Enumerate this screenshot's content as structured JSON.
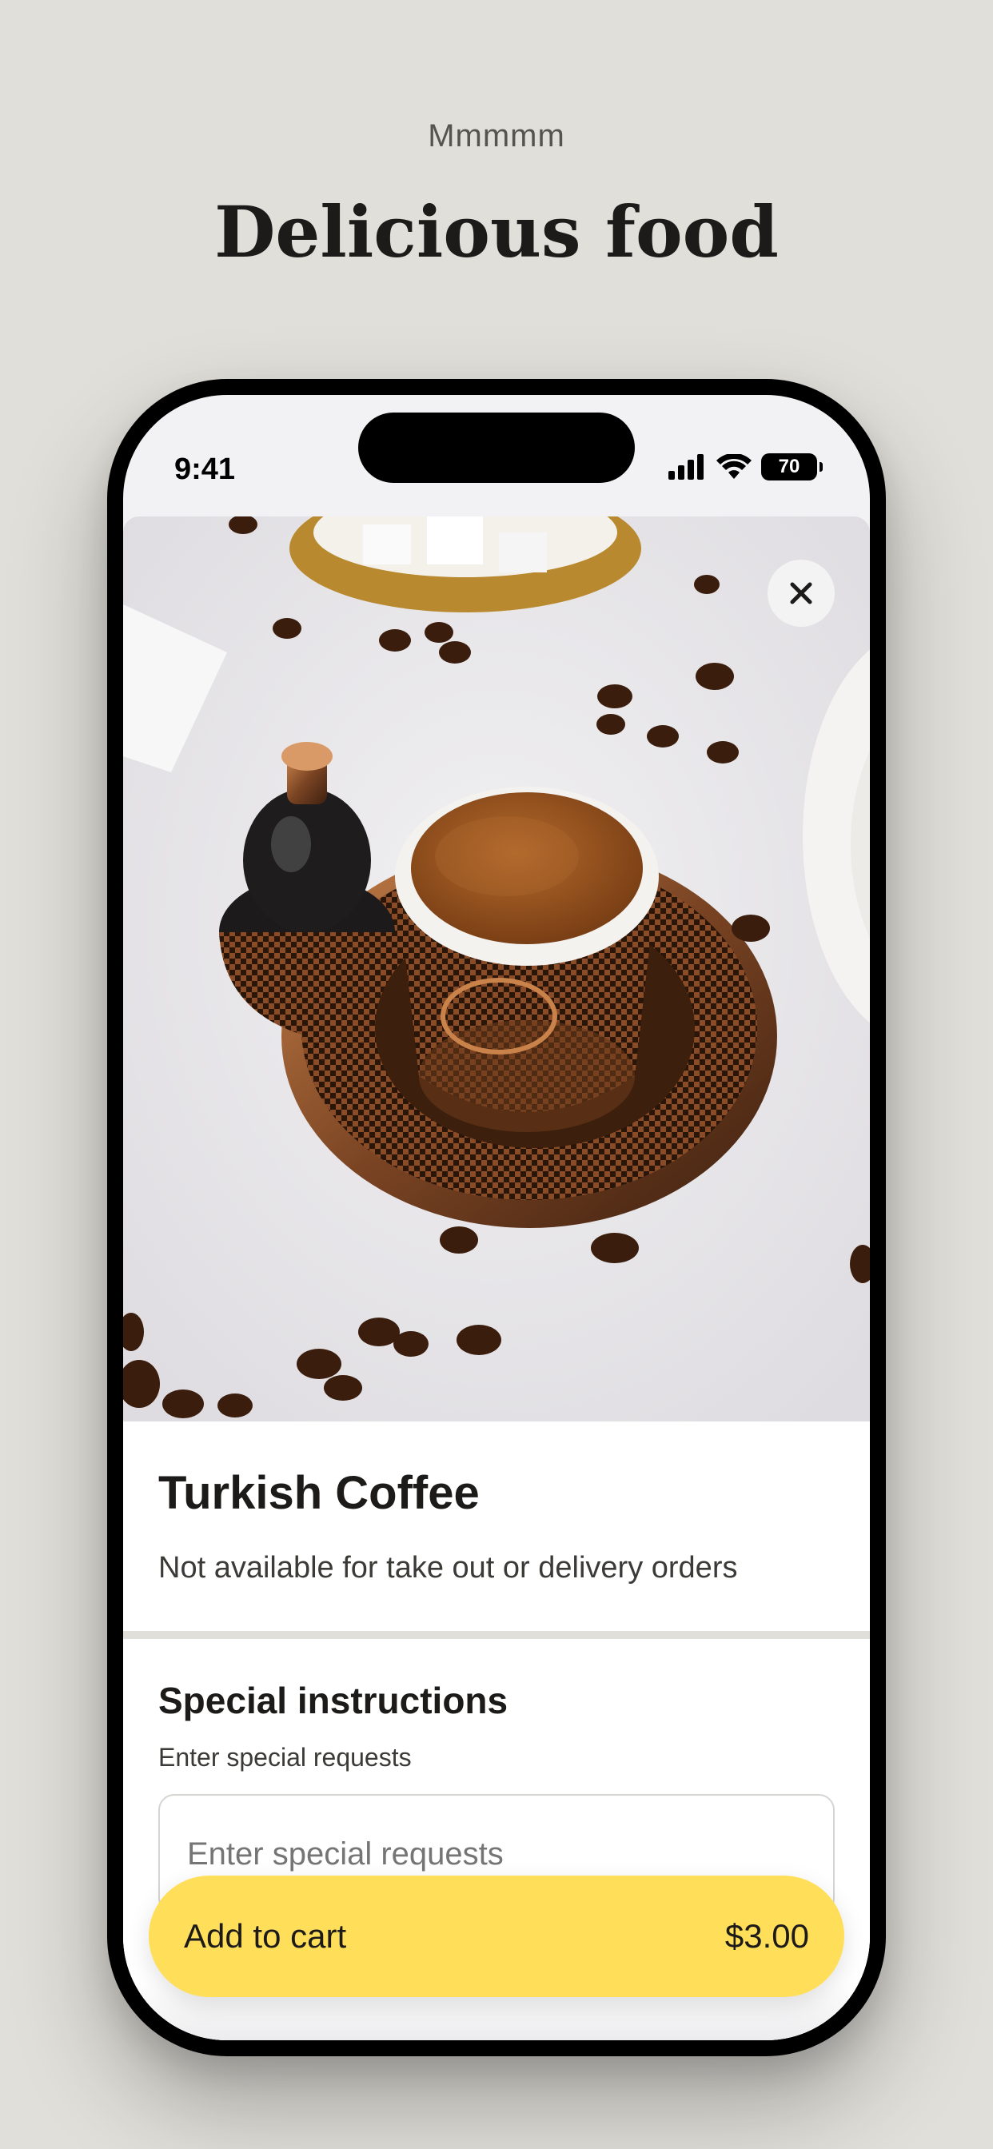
{
  "header": {
    "eyebrow": "Mmmmm",
    "headline": "Delicious food"
  },
  "status_bar": {
    "time": "9:41",
    "battery": "70",
    "icons": [
      "signal-icon",
      "wifi-icon",
      "battery-icon"
    ]
  },
  "item": {
    "title": "Turkish Coffee",
    "note": "Not available for take out or delivery orders",
    "image_icon": "turkish-coffee-photo"
  },
  "instructions": {
    "title": "Special instructions",
    "label": "Enter special requests",
    "placeholder": "Enter special requests",
    "value": ""
  },
  "cart": {
    "label": "Add to cart",
    "price": "$3.00"
  },
  "colors": {
    "background": "#e1dfd9",
    "accent": "#ffde59",
    "text": "#1c1b19"
  }
}
